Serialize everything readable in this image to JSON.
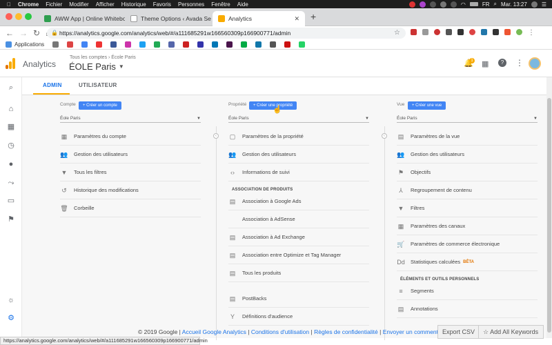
{
  "menubar": {
    "app": "Chrome",
    "items": [
      "Fichier",
      "Modifier",
      "Afficher",
      "Historique",
      "Favoris",
      "Personnes",
      "Fenêtre",
      "Aide"
    ],
    "lang": "FR",
    "clock": "Mar. 13:27"
  },
  "tabs": [
    {
      "title": "AWW App | Online Whiteboard",
      "color": "#2e9e4f"
    },
    {
      "title": "Theme Options ‹ Avada Seo –",
      "color": "#999"
    },
    {
      "title": "Analytics",
      "color": "#f9ab00"
    }
  ],
  "address": {
    "url": "https://analytics.google.com/analytics/web/#/a111685291w166560309p166900771/admin"
  },
  "bookmarks": {
    "label": "Applications"
  },
  "header": {
    "product": "Analytics",
    "breadcrumb": "Tous les comptes › École Paris",
    "account": "ÉOLE Paris",
    "notif_count": "1"
  },
  "subtabs": {
    "admin": "ADMIN",
    "user": "UTILISATEUR"
  },
  "columns": {
    "compte": {
      "label": "Compte",
      "create": "+ Créer un compte",
      "select": "Éole Paris",
      "items": [
        {
          "icon": "building-icon",
          "glyph": "▦",
          "label": "Paramètres du compte"
        },
        {
          "icon": "users-icon",
          "glyph": "👥",
          "label": "Gestion des utilisateurs"
        },
        {
          "icon": "filter-icon",
          "glyph": "▼",
          "label": "Tous les filtres"
        },
        {
          "icon": "history-icon",
          "glyph": "↺",
          "label": "Historique des modifications"
        },
        {
          "icon": "trash-icon",
          "glyph": "🗑",
          "label": "Corbeille"
        }
      ]
    },
    "propriete": {
      "label": "Propriété",
      "create": "+ Créer une propriété",
      "select": "Éole Paris",
      "items": [
        {
          "icon": "page-icon",
          "glyph": "▢",
          "label": "Paramètres de la propriété"
        },
        {
          "icon": "users-icon",
          "glyph": "👥",
          "label": "Gestion des utilisateurs"
        },
        {
          "icon": "code-icon",
          "glyph": "‹›",
          "label": "Informations de suivi"
        }
      ],
      "section": "ASSOCIATION DE PRODUITS",
      "products": [
        {
          "icon": "ads-icon",
          "glyph": "▤",
          "label": "Association à Google Ads"
        },
        {
          "icon": "adsense-icon",
          "glyph": "",
          "label": "Association à AdSense"
        },
        {
          "icon": "adexchange-icon",
          "glyph": "▤",
          "label": "Association à Ad Exchange"
        },
        {
          "icon": "optimize-icon",
          "glyph": "▤",
          "label": "Association entre Optimize et Tag Manager"
        },
        {
          "icon": "products-icon",
          "glyph": "▤",
          "label": "Tous les produits"
        }
      ],
      "more": [
        {
          "icon": "postbacks-icon",
          "glyph": "▤",
          "label": "PostBacks"
        },
        {
          "icon": "audience-icon",
          "glyph": "Y",
          "label": "Définitions d'audience"
        }
      ]
    },
    "vue": {
      "label": "Vue",
      "create": "+ Créer une vue",
      "select": "Éole Paris",
      "items": [
        {
          "icon": "doc-icon",
          "glyph": "▤",
          "label": "Paramètres de la vue"
        },
        {
          "icon": "users-icon",
          "glyph": "👥",
          "label": "Gestion des utilisateurs"
        },
        {
          "icon": "flag-icon",
          "glyph": "⚑",
          "label": "Objectifs"
        },
        {
          "icon": "grouping-icon",
          "glyph": "⅄",
          "label": "Regroupement de contenu"
        },
        {
          "icon": "filter-icon",
          "glyph": "▼",
          "label": "Filtres"
        },
        {
          "icon": "channels-icon",
          "glyph": "▦",
          "label": "Paramètres des canaux"
        },
        {
          "icon": "cart-icon",
          "glyph": "🛒",
          "label": "Paramètres de commerce électronique"
        },
        {
          "icon": "dd-icon",
          "glyph": "Dd",
          "label": "Statistiques calculées",
          "badge": "BÊTA"
        }
      ],
      "section": "ÉLÉMENTS ET OUTILS PERSONNELS",
      "tools": [
        {
          "icon": "segments-icon",
          "glyph": "≡",
          "label": "Segments"
        },
        {
          "icon": "annotations-icon",
          "glyph": "▤",
          "label": "Annotations"
        }
      ]
    }
  },
  "footer": {
    "copyright": "© 2019 Google |",
    "home": "Accueil Google Analytics",
    "sep1": "|",
    "terms": "Conditions d'utilisation",
    "sep2": "|",
    "privacy": "Règles de confidentialité",
    "sep3": "|",
    "feedback": "Envoyer un commentaire"
  },
  "buttons": {
    "export": "Export CSV",
    "keywords": "☆ Add All Keywords"
  },
  "statusbar": "https://analytics.google.com/analytics/web/#/a111685291w166560309p166900771/admin",
  "colors": {
    "accent": "#4285f4",
    "ga_orange": "#f9ab00",
    "ga_dark": "#e37400"
  }
}
